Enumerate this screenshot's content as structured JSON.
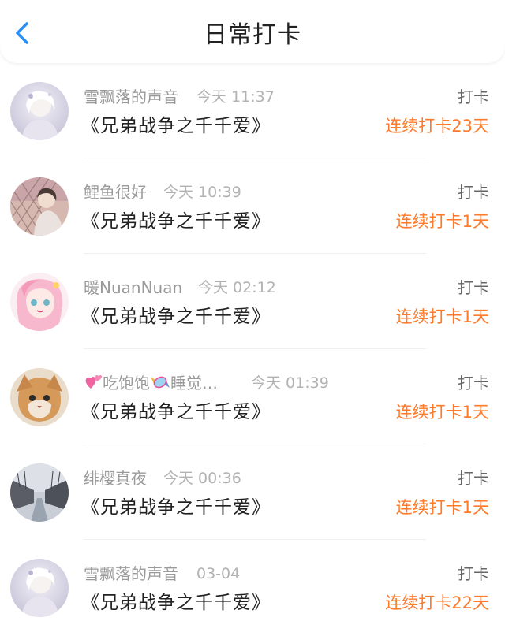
{
  "header": {
    "title": "日常打卡",
    "back_icon": "chevron-left-icon",
    "accent_color": "#2b8ff5"
  },
  "colors": {
    "streak": "#ff7a2a",
    "username": "#999999",
    "title_text": "#222222"
  },
  "checkins": [
    {
      "username": "雪飘落的声音",
      "time": "今天 11:37",
      "book": "《兄弟战争之千千爱》",
      "action": "打卡",
      "streak": "连续打卡23天",
      "avatar": "girl-white-avatar"
    },
    {
      "username": "鲤鱼很好",
      "time": "今天 10:39",
      "book": "《兄弟战争之千千爱》",
      "action": "打卡",
      "streak": "连续打卡1天",
      "avatar": "boy-fence-avatar"
    },
    {
      "username": "暖NuanNuan",
      "time": "今天 02:12",
      "book": "《兄弟战争之千千爱》",
      "action": "打卡",
      "streak": "连续打卡1天",
      "avatar": "pink-anime-girl-avatar"
    },
    {
      "username": "吃饱饱",
      "username_suffix": "睡觉…",
      "username_icons": [
        "hearts-icon",
        "candy-icon"
      ],
      "time": "今天 01:39",
      "book": "《兄弟战争之千千爱》",
      "action": "打卡",
      "streak": "连续打卡1天",
      "avatar": "cat-hat-avatar"
    },
    {
      "username": "绯樱真夜",
      "time": "今天 00:36",
      "book": "《兄弟战争之千千爱》",
      "action": "打卡",
      "streak": "连续打卡1天",
      "avatar": "canal-street-avatar"
    },
    {
      "username": "雪飘落的声音",
      "time": "03-04",
      "book": "《兄弟战争之千千爱》",
      "action": "打卡",
      "streak": "连续打卡22天",
      "avatar": "girl-white-avatar"
    }
  ]
}
